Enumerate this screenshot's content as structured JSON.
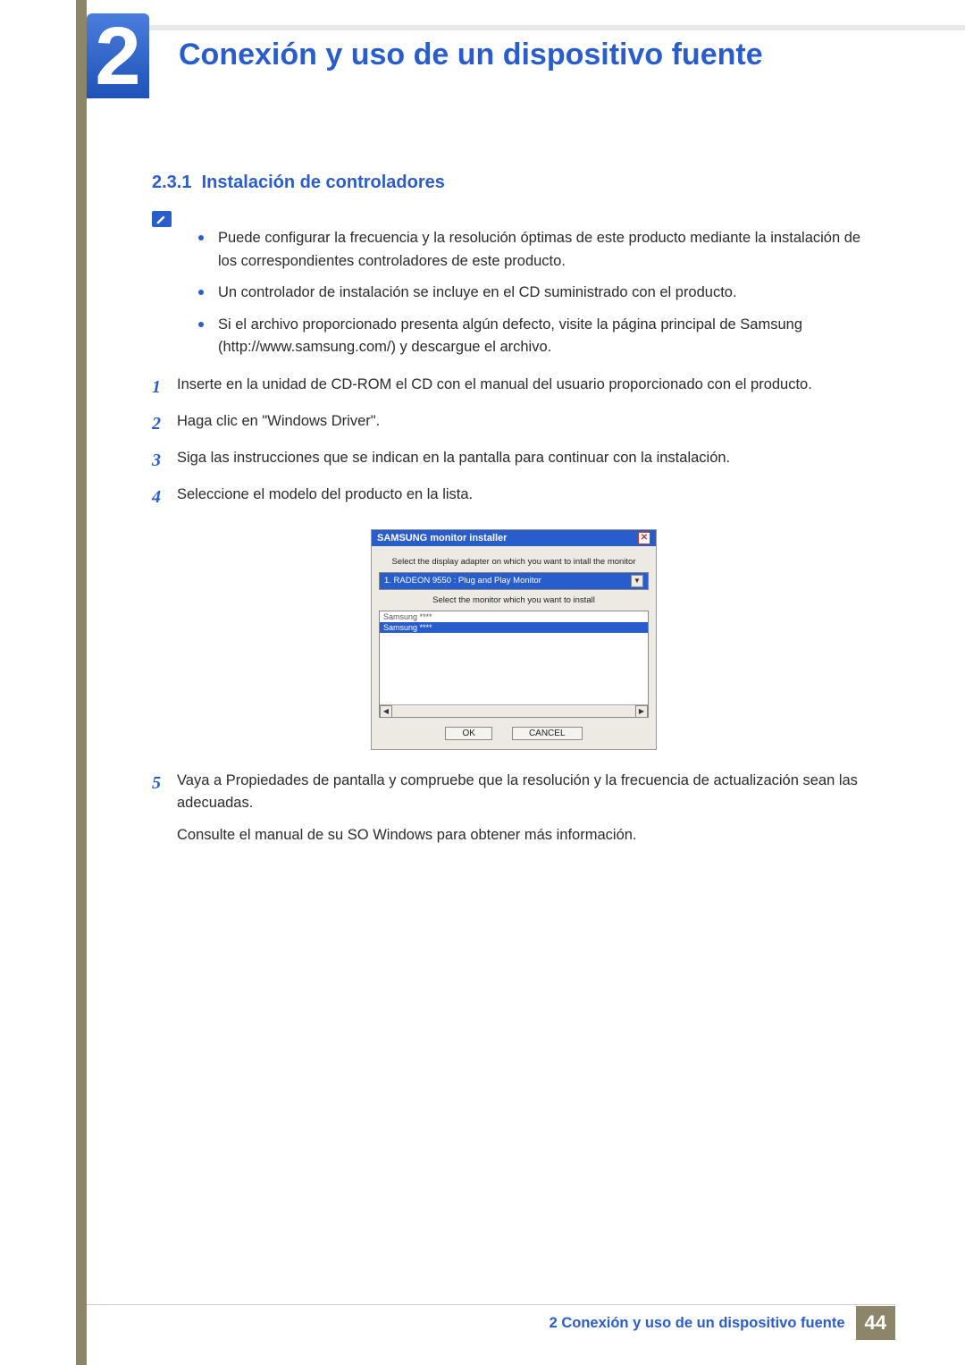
{
  "chapter": {
    "number": "2",
    "title": "Conexión y uso de un dispositivo fuente"
  },
  "section": {
    "number": "2.3.1",
    "title": "Instalación de controladores"
  },
  "notes": [
    "Puede configurar la frecuencia y la resolución óptimas de este producto mediante la instalación de los correspondientes controladores de este producto.",
    "Un controlador de instalación se incluye en el CD suministrado con el producto.",
    "Si el archivo proporcionado presenta algún defecto, visite la página principal de Samsung (http://www.samsung.com/) y descargue el archivo."
  ],
  "steps": [
    "Inserte en la unidad de CD-ROM el CD con el manual del usuario proporcionado con el producto.",
    "Haga clic en \"Windows Driver\".",
    "Siga las instrucciones que se indican en la pantalla para continuar con la instalación.",
    "Seleccione el modelo del producto en la lista.",
    "Vaya a Propiedades de pantalla y compruebe que la resolución y la frecuencia de actualización sean las adecuadas."
  ],
  "step5_extra": "Consulte el manual de su SO Windows para obtener más información.",
  "installer": {
    "window_title": "SAMSUNG monitor installer",
    "label1": "Select the display adapter on which you want to intall the monitor",
    "dropdown_selected": "1. RADEON 9550 : Plug and Play Monitor",
    "label2": "Select the monitor which you want to install",
    "list": [
      "Samsung ****",
      "Samsung ****"
    ],
    "ok": "OK",
    "cancel": "CANCEL"
  },
  "footer": {
    "text": "2 Conexión y uso de un dispositivo fuente",
    "page": "44"
  }
}
